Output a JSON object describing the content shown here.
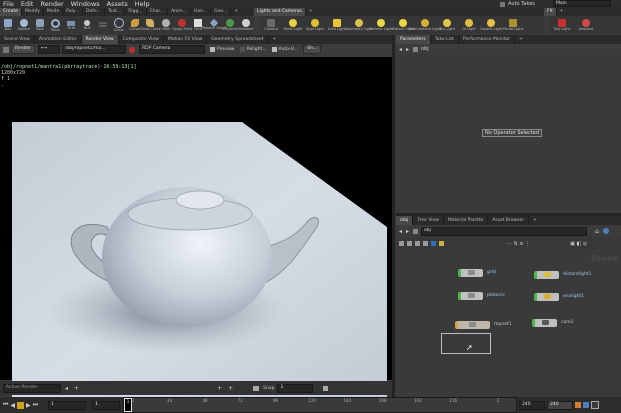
{
  "menu": [
    "File",
    "Edit",
    "Render",
    "Windows",
    "Assets",
    "Help"
  ],
  "top_right": {
    "auto_takes": "Auto Takes",
    "desktop": "Main"
  },
  "shelf_tabs_left": [
    "Create",
    "Modify",
    "Mode",
    "Poly...",
    "Defo...",
    "Text...",
    "Rigg...",
    "Char...",
    "Anim...",
    "Hair...",
    "Geo..."
  ],
  "shelf_tabs_right": [
    "Lights and Cameras"
  ],
  "shelf_tools_left": [
    "Box",
    "Sphere",
    "Tube",
    "Torus",
    "Grid",
    "Null",
    "Line",
    "Circle",
    "Curve",
    "Draw Curve",
    "Path",
    "Spray Paint",
    "Font",
    "Platonic Solids",
    "L-System",
    "Metaball",
    "File"
  ],
  "shelf_tools_right": [
    "Camera",
    "Point Light",
    "Spot Light",
    "Area Light",
    "Geometry Light",
    "Volume Light",
    "Distant Light",
    "Environment Light",
    "Sky Light",
    "GI Light",
    "Caustic Light",
    "Portal Light"
  ],
  "shelf_tools_far": [
    "Sky Light",
    "Ambient"
  ],
  "left_tabs": [
    "Scene View",
    "Animation Editor",
    "Render View",
    "Composite View",
    "Motion FX View",
    "Geometry Spreadsheet"
  ],
  "render_toolbar": {
    "render": "Render",
    "path": "/obj/ropnet1/ma...",
    "camera": "RDP Camera",
    "preview": "Preview",
    "relight": "Relight...",
    "auto": "Auto-U...",
    "snap": "Sh..."
  },
  "render_info": [
    "/obj/ropnet1/mantra1(pbrraytrace)-16:59:13[1]",
    "1280x720",
    "f 1",
    "."
  ],
  "render_footer": {
    "active_render": "Active Render",
    "snap": "Snap",
    "snap_value": "1"
  },
  "right_top_tabs": [
    "Parameters",
    "Take List",
    "Performance Monitor"
  ],
  "params_path": "obj",
  "no_operator": "No Operator Selected",
  "right_bottom_tabs": [
    "/obj",
    "Tree View",
    "Material Palette",
    "Asset Browser"
  ],
  "network_path": "obj",
  "network_label": "Scene",
  "nodes": [
    {
      "name": "grid",
      "color": "#4cb84c"
    },
    {
      "name": "platonic",
      "color": "#4cb84c"
    },
    {
      "name": "ropnet1",
      "color": "#d8a050"
    },
    {
      "name": "distantlight1",
      "color": "#4cb84c"
    },
    {
      "name": "envlight1",
      "color": "#4cb84c"
    },
    {
      "name": "cam1",
      "color": "#4cb84c"
    }
  ],
  "timeline": {
    "frame": "1",
    "start": "1",
    "step": "1",
    "end": "240",
    "end2": "240",
    "ticks": [
      "1",
      "24",
      "48",
      "72",
      "96",
      "120",
      "144",
      "168",
      "192",
      "216",
      "2"
    ]
  },
  "colors": {
    "accent": "#4cb84c",
    "panel": "#3a3a3a",
    "dark": "#2a2a2a",
    "viewport": "#000000"
  }
}
